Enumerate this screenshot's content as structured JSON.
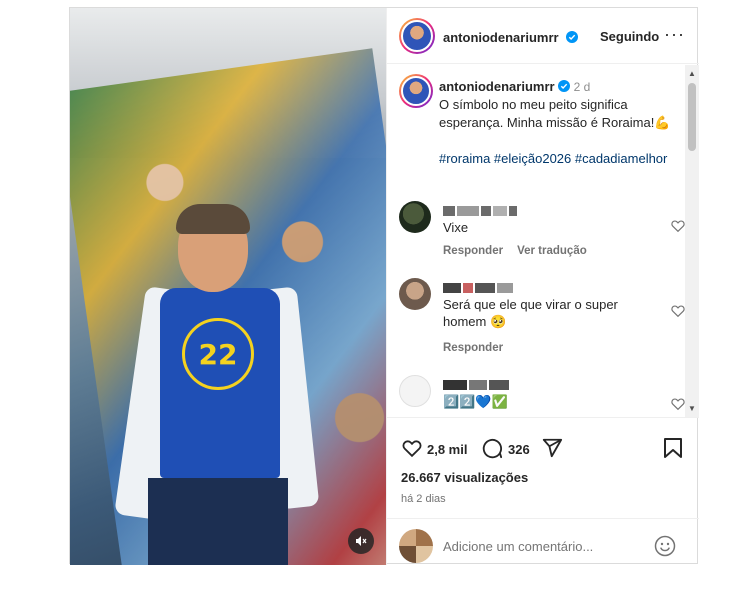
{
  "post": {
    "author": "antoniodenariumrr",
    "follow_label": "Seguindo",
    "more_label": "···",
    "caption": {
      "author": "antoniodenariumrr",
      "time": "2 d",
      "text": "O símbolo no meu peito significa esperança. Minha missão é Roraima!💪",
      "hashtags": "#roraima #eleição2026 #cadadiamelhor"
    },
    "media": {
      "shirt_number": "22"
    }
  },
  "comments": [
    {
      "text": "Vixe",
      "reply_label": "Responder",
      "translate_label": "Ver tradução"
    },
    {
      "text": "Será que ele que virar o super homem 🥺",
      "reply_label": "Responder"
    },
    {
      "text": "2️⃣2️⃣💙✅"
    }
  ],
  "footer": {
    "likes": "2,8 mil",
    "comments_count": "326",
    "views": "26.667 visualizações",
    "ago": "há 2 dias",
    "comment_placeholder": "Adicione um comentário..."
  },
  "colors": {
    "link": "#00376b",
    "verified": "#0095f6",
    "muted": "#737373"
  }
}
